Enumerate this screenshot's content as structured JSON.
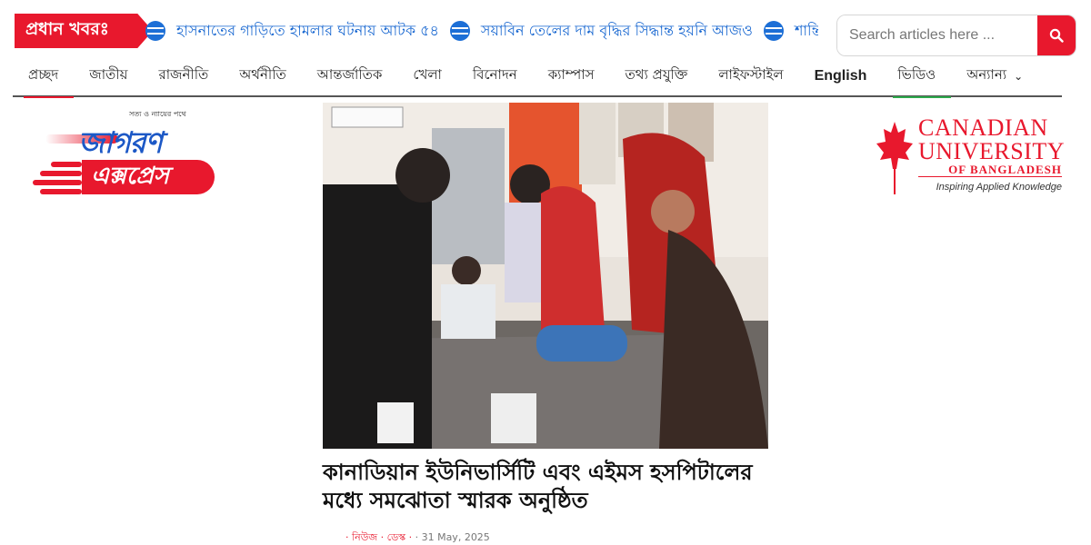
{
  "ticker": {
    "label": "প্রধান খবরঃ",
    "items": [
      "হাসনাতের গাড়িতে হামলার ঘটনায় আটক ৫৪",
      "সয়াবিন তেলের দাম বৃদ্ধির সিদ্ধান্ত হয়নি আজও",
      "শান্তি"
    ]
  },
  "search": {
    "placeholder": "Search articles here ..."
  },
  "nav": {
    "items": [
      "প্রচ্ছদ",
      "জাতীয়",
      "রাজনীতি",
      "অর্থনীতি",
      "আন্তর্জাতিক",
      "খেলা",
      "বিনোদন",
      "ক্যাম্পাস",
      "তথ্য প্রযুক্তি",
      "লাইফস্টাইল",
      "English",
      "ভিডিও",
      "অন্যান্য"
    ]
  },
  "logo": {
    "tagline": "সত্য ও ন্যায়ের পথে",
    "top": "জাগরণ",
    "bottom": "এক্সপ্রেস"
  },
  "ad": {
    "line1": "CANADIAN",
    "line2": "UNIVERSITY",
    "line3": "OF BANGLADESH",
    "slogan": "Inspiring Applied Knowledge"
  },
  "article": {
    "headline": "কানাডিয়ান ইউনিভার্সিটি এবং এইমস হসপিটালের মধ্যে সমঝোতা স্মারক অনুষ্ঠিত",
    "category": "· নিউজ · ডেস্ক ·",
    "date": "· 31 May, 2025"
  },
  "colors": {
    "accent": "#e8182d",
    "link": "#1565d0",
    "brand_blue": "#1c58c6"
  },
  "icons": {
    "ticker": "globe-icon",
    "search": "search-icon",
    "dropdown": "chevron-down-icon",
    "ad": "maple-leaf-icon"
  }
}
